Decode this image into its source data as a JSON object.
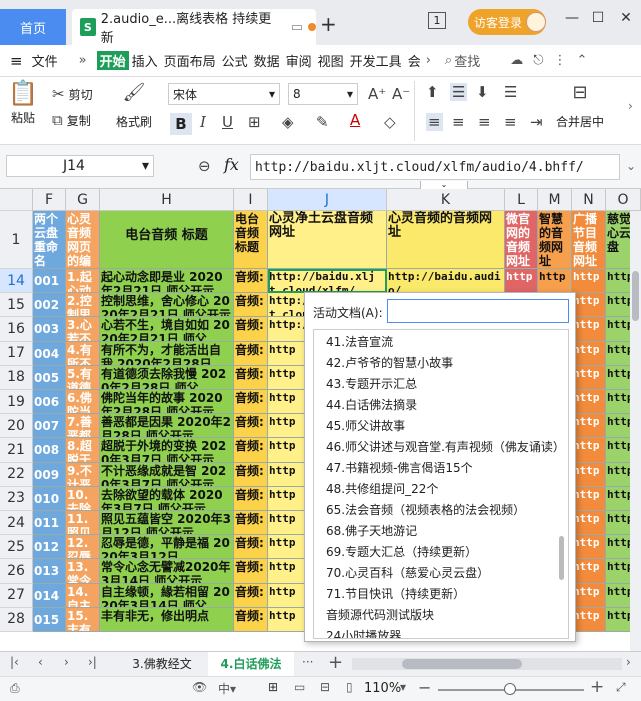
{
  "titlebar": {
    "home_tab": "首页",
    "doc_icon": "S",
    "doc_title": "2.audio_e...离线表格 持续更新",
    "add_tab": "+",
    "page_indicator": "1",
    "login": "访客登录"
  },
  "menubar": {
    "file": "文件",
    "items": [
      "开始",
      "插入",
      "页面布局",
      "公式",
      "数据",
      "审阅",
      "视图",
      "开发工具",
      "会"
    ],
    "search": "查找"
  },
  "ribbon": {
    "paste": "粘贴",
    "cut": "剪切",
    "copy": "复制",
    "format_painter": "格式刷",
    "font_name": "宋体",
    "font_size": "8",
    "merge": "合并居中"
  },
  "formula": {
    "cell_ref": "J14",
    "fx": "fx",
    "value": "http://baidu.xljt.cloud/xlfm/audio/4.bhff/"
  },
  "columns": [
    {
      "label": "F"
    },
    {
      "label": "G"
    },
    {
      "label": "H"
    },
    {
      "label": "I"
    },
    {
      "label": "J"
    },
    {
      "label": "K"
    },
    {
      "label": "L"
    },
    {
      "label": "M"
    },
    {
      "label": "N"
    },
    {
      "label": "O"
    }
  ],
  "header_row": {
    "num": "1",
    "F": "两个云盘重命名",
    "G": "心灵音频网页的编",
    "H": "电台音频 标题",
    "I": "电台音频标题",
    "J": "心灵净土云盘音频网址",
    "K": "心灵音频的音频网址",
    "L": "微官网的音频网址",
    "M": "智慧的音频网址",
    "N": "广播节目音频网址",
    "O": "慈觉心云盘"
  },
  "rows": [
    {
      "num": "14",
      "F": "001",
      "G": "1.起心动",
      "H": "起心动念即是业 2020年2月21日 师父开示",
      "I": "音频:",
      "J": "http://baidu.xljt.cloud/xlfm/",
      "K": "http://baidu.audio/",
      "L": "http",
      "M": "http",
      "N": "http",
      "O": "http"
    },
    {
      "num": "15",
      "F": "002",
      "G": "2.控制思",
      "H": "控制思维，舍心修心 2020年2月21日 师父开示",
      "I": "音频:",
      "J": "http://baidu.xljt.cloud",
      "K": "http://baidu",
      "L": "http",
      "M": "http",
      "N": "http",
      "O": "http"
    },
    {
      "num": "16",
      "F": "003",
      "G": "3.心若不生",
      "H": "心若不生，境自如如 2020年2月21日 师父",
      "I": "音频:",
      "J": "http://baidu",
      "K": "http",
      "L": "http",
      "M": "http",
      "N": "http",
      "O": "http"
    },
    {
      "num": "17",
      "F": "004",
      "G": "4.有所不为",
      "H": "有所不为，才能活出自我 2020年2月28日",
      "I": "音频:",
      "J": "http",
      "K": "http",
      "L": "http",
      "M": "http",
      "N": "http",
      "O": "http"
    },
    {
      "num": "18",
      "F": "005",
      "G": "5.有道德",
      "H": "有道德须去除我慢 2020年2月28日 师父",
      "I": "音频:",
      "J": "http",
      "K": "http",
      "L": "http",
      "M": "http",
      "N": "http",
      "O": "http"
    },
    {
      "num": "19",
      "F": "006",
      "G": "6.佛陀当年",
      "H": "佛陀当年的故事 2020年2月28日 师父开示",
      "I": "音频:",
      "J": "http",
      "K": "http",
      "L": "http",
      "M": "http",
      "N": "http",
      "O": "http"
    },
    {
      "num": "20",
      "F": "007",
      "G": "7.善恶都",
      "H": "善恶都是因果 2020年2月28日 师父开示",
      "I": "音频:",
      "J": "http",
      "K": "http",
      "L": "http",
      "M": "http",
      "N": "http",
      "O": "http"
    },
    {
      "num": "21",
      "F": "008",
      "G": "8.超脱于",
      "H": "超脱于外境的变换 2020年3月7日 师父开示",
      "I": "音频:",
      "J": "http",
      "K": "http",
      "L": "http",
      "M": "http",
      "N": "http",
      "O": "http"
    },
    {
      "num": "22",
      "F": "009",
      "G": "9.不计恶",
      "H": "不计恶缘成就是智 2020年3月7日 师父开示",
      "I": "音频:",
      "J": "http",
      "K": "http",
      "L": "http",
      "M": "http",
      "N": "http",
      "O": "http"
    },
    {
      "num": "23",
      "F": "010",
      "G": "10.去除",
      "H": "去除欲望的载体 2020年3月7日 师父开示",
      "I": "音频:",
      "J": "http",
      "K": "http",
      "L": "http",
      "M": "http",
      "N": "http",
      "O": "http"
    },
    {
      "num": "24",
      "F": "011",
      "G": "11.照见",
      "H": "照见五蕴皆空 2020年3月12日 师父开示",
      "I": "音频:",
      "J": "http",
      "K": "http",
      "L": "http",
      "M": "http",
      "N": "http",
      "O": "http"
    },
    {
      "num": "25",
      "F": "012",
      "G": "12.忍辱",
      "H": "忍辱是德，平静是福 2020年3月12日",
      "I": "音频:",
      "J": "http",
      "K": "http",
      "L": "http",
      "M": "http",
      "N": "http",
      "O": "http"
    },
    {
      "num": "26",
      "F": "013",
      "G": "13.常令",
      "H": "常令心念无譬减2020年3月14日 师父开示",
      "I": "音频:",
      "J": "http",
      "K": "http",
      "L": "http",
      "M": "http",
      "N": "http",
      "O": "http"
    },
    {
      "num": "27",
      "F": "014",
      "G": "14.自主",
      "H": "自主缘顿，緣若相留 2020年3月14日 师父",
      "I": "音频:",
      "J": "http",
      "K": "http",
      "L": "http",
      "M": "http",
      "N": "http",
      "O": "http"
    },
    {
      "num": "28",
      "F": "015",
      "G": "15.丰有",
      "H": "丰有非无，修出明点",
      "I": "音频:",
      "J": "http",
      "K": "http",
      "L": "http",
      "M": "http",
      "N": "http",
      "O": "http"
    }
  ],
  "popup": {
    "label": "活动文档(A):",
    "input_value": "",
    "items": [
      "41.法音宣流",
      "42.卢爷爷的智慧小故事",
      "43.专题开示汇总",
      "44.白话佛法摘录",
      "45.师父讲故事",
      "46.师父讲述与观音堂.有声视频（佛友诵读）",
      "47.书籍视频-佛言偈语15个",
      "48.共修组提问_22个",
      "65.法会音频（视频表格的法会视频）",
      "68.佛子天地游记",
      "69.专题大汇总（持续更新）",
      "70.心灵百科（慈爱心灵云盘）",
      "71.节目快讯（持续更新）",
      "音频源代码测试版块",
      "24小时播放器"
    ]
  },
  "sheettabs": {
    "tabs": [
      "3.佛教经文",
      "4.白话佛法"
    ],
    "active": "4.白话佛法",
    "more": "···",
    "add": "+"
  },
  "status": {
    "zoom": "110%"
  },
  "colors": {
    "home_blue": "#4a8cf0",
    "F_blue": "#6fa8dc",
    "G_orange": "#f4a460",
    "H_green": "#8fd14f",
    "I_yellow": "#fcd24b",
    "J_yellow": "#fff08a",
    "K_yellow": "#fbe96b",
    "L_red": "#e06666",
    "M_orange": "#f6a04d",
    "N_orange": "#f28b3c",
    "O_green": "#9bd36a"
  }
}
